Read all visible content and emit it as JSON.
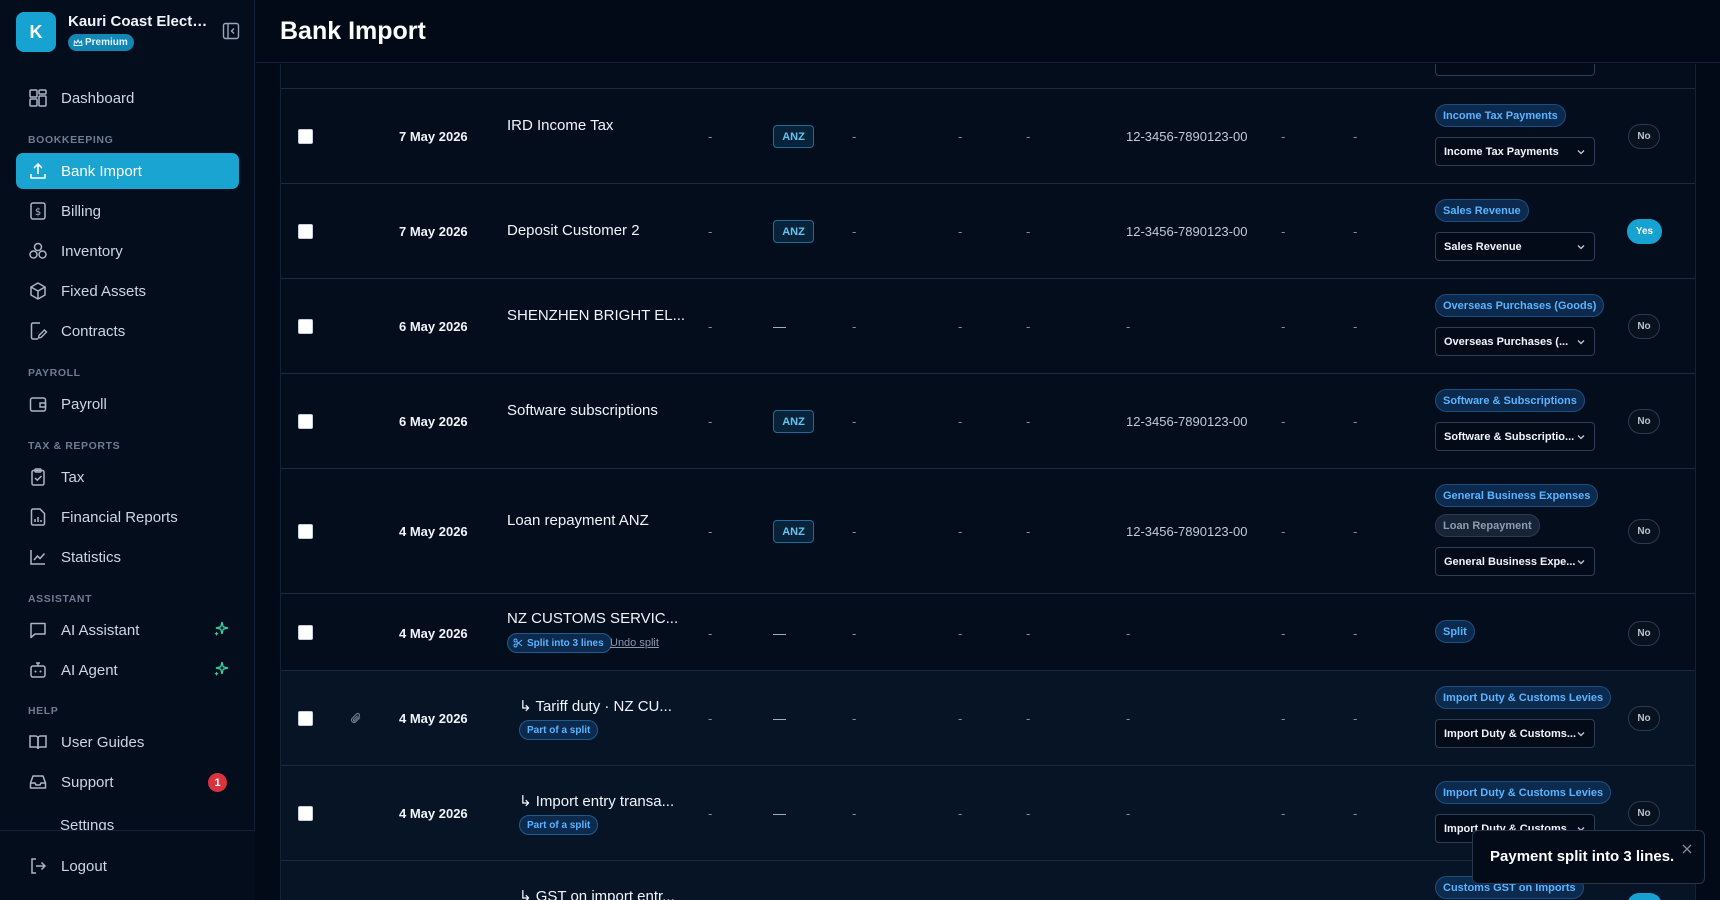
{
  "org": {
    "initial": "K",
    "name": "Kauri Coast Electri...",
    "plan": "Premium"
  },
  "sidebar": {
    "top_item": {
      "label": "Dashboard"
    },
    "sections": {
      "bookkeeping": "BOOKKEEPING",
      "payroll": "PAYROLL",
      "tax_reports": "TAX & REPORTS",
      "assistant": "ASSISTANT",
      "help": "HELP"
    },
    "items": {
      "bank_import": "Bank Import",
      "billing": "Billing",
      "inventory": "Inventory",
      "fixed_assets": "Fixed Assets",
      "contracts": "Contracts",
      "payroll": "Payroll",
      "tax": "Tax",
      "financial_reports": "Financial Reports",
      "statistics": "Statistics",
      "ai_assistant": "AI Assistant",
      "ai_agent": "AI Agent",
      "user_guides": "User Guides",
      "support": "Support",
      "partial": "Settings"
    },
    "support_badge": "1",
    "logout": "Logout"
  },
  "header": {
    "title": "Bank Import"
  },
  "table": {
    "dash": "-",
    "emdash": "—",
    "rows": [
      {
        "date": "7 May 2026",
        "description": "IRD Income Tax",
        "bank": "ANZ",
        "account": "12-3456-7890123-00",
        "tags": [
          "Income Tax Payments"
        ],
        "category": "Income Tax Payments",
        "gst": "No"
      },
      {
        "date": "7 May 2026",
        "description": "Deposit Customer 2",
        "bank": "ANZ",
        "account": "12-3456-7890123-00",
        "tags": [
          "Sales Revenue"
        ],
        "category": "Sales Revenue",
        "gst": "Yes"
      },
      {
        "date": "6 May 2026",
        "description": "SHENZHEN BRIGHT EL...",
        "bank": "—",
        "account": "-",
        "tags": [
          "Overseas Purchases (Goods)"
        ],
        "category": "Overseas Purchases (...",
        "gst": "No"
      },
      {
        "date": "6 May 2026",
        "description": "Software subscriptions",
        "bank": "ANZ",
        "account": "12-3456-7890123-00",
        "tags": [
          "Software & Subscriptions"
        ],
        "category": "Software & Subscriptio...",
        "gst": "No"
      },
      {
        "date": "4 May 2026",
        "description": "Loan repayment ANZ",
        "bank": "ANZ",
        "account": "12-3456-7890123-00",
        "tags": [
          "General Business Expenses",
          "Loan Repayment"
        ],
        "category": "General Business Expe...",
        "gst": "No"
      },
      {
        "date": "4 May 2026",
        "description": "NZ CUSTOMS SERVIC...",
        "split_label": "Split into 3 lines",
        "undo_label": "Undo split",
        "bank": "—",
        "account": "-",
        "tags": [
          "Split"
        ],
        "gst": "No"
      },
      {
        "date": "4 May 2026",
        "description": "↳ Tariff duty · NZ CU...",
        "part_label": "Part of a split",
        "bank": "—",
        "account": "-",
        "tags": [
          "Import Duty & Customs Levies"
        ],
        "category": "Import Duty & Customs...",
        "gst": "No"
      },
      {
        "date": "4 May 2026",
        "description": "↳ Import entry transa...",
        "part_label": "Part of a split",
        "bank": "—",
        "account": "-",
        "tags": [
          "Import Duty & Customs Levies"
        ],
        "category": "Import Duty & Customs...",
        "gst": "No"
      },
      {
        "description": "↳ GST on import entr...",
        "tags": [
          "Customs GST on Imports"
        ]
      }
    ]
  },
  "toast": {
    "message": "Payment split into 3 lines."
  }
}
